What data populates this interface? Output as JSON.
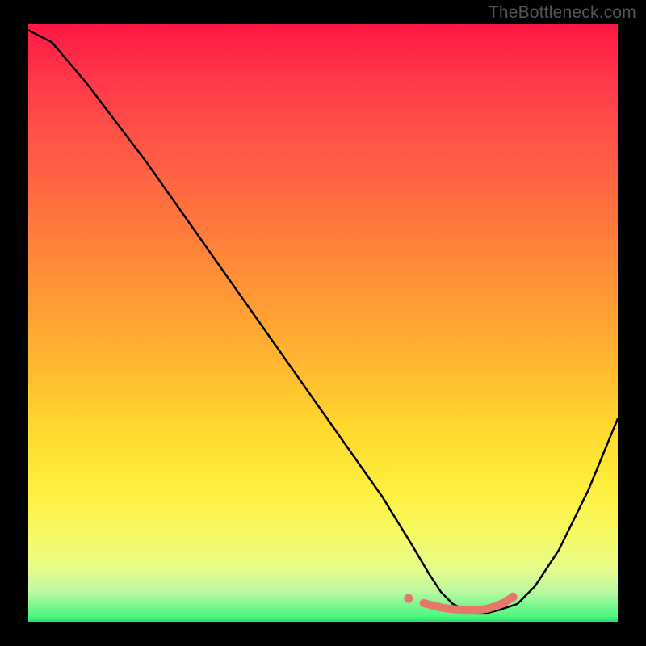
{
  "watermark": "TheBottleneck.com",
  "chart_data": {
    "type": "line",
    "title": "",
    "xlabel": "",
    "ylabel": "",
    "xlim": [
      0,
      100
    ],
    "ylim": [
      0,
      100
    ],
    "grid": false,
    "legend": false,
    "series": [
      {
        "name": "curve",
        "x": [
          0,
          4,
          10,
          20,
          30,
          40,
          50,
          60,
          65,
          68,
          70,
          72,
          74,
          76,
          78,
          80,
          83,
          86,
          90,
          95,
          100
        ],
        "values": [
          99,
          97,
          90,
          77,
          63,
          49,
          35,
          21,
          13,
          8,
          5,
          3,
          2,
          1.5,
          1.5,
          2,
          3,
          6,
          12,
          22,
          34
        ]
      }
    ],
    "markers": {
      "name": "highlight-dots",
      "x": [
        64.5,
        66.8,
        69.0,
        70.5,
        71.7,
        73.0,
        74.5,
        76.0,
        77.5,
        79.2,
        80.8,
        82.2
      ],
      "values": [
        3.9,
        3.2,
        2.6,
        2.3,
        2.15,
        2.05,
        2.0,
        2.0,
        2.1,
        2.55,
        3.25,
        4.15
      ]
    }
  }
}
